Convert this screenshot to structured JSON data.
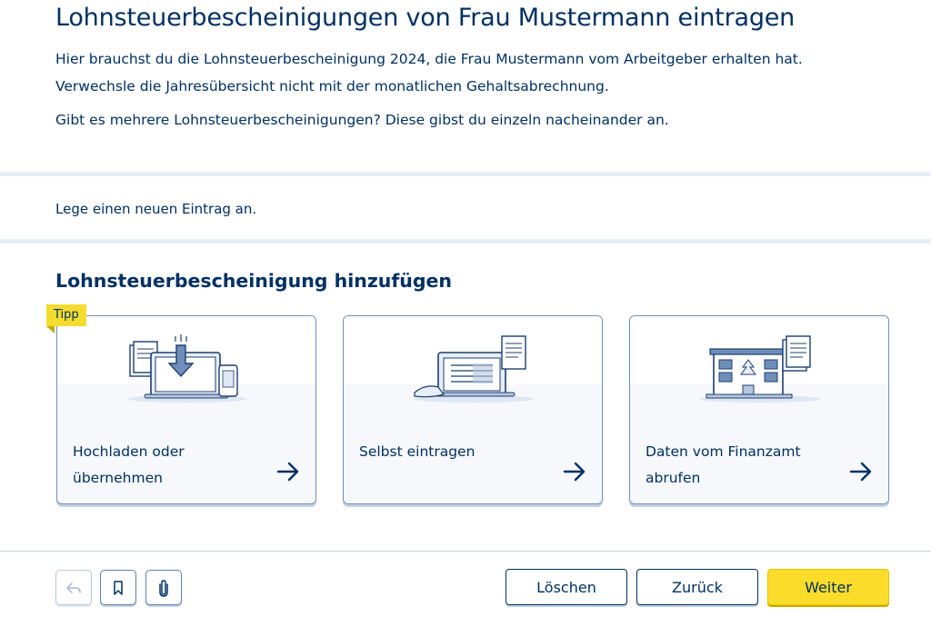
{
  "page": {
    "title": "Lohnsteuerbescheinigungen von Frau Mustermann eintragen",
    "intro_line1": "Hier brauchst du die Lohnsteuerbescheinigung 2024, die Frau Mustermann vom Arbeitgeber erhalten hat.",
    "intro_line2": "Verwechsle die Jahresübersicht nicht mit der monatlichen Gehaltsabrechnung.",
    "intro_line3": "Gibt es mehrere Lohnsteuerbescheinigungen? Diese gibst du einzeln nacheinander an."
  },
  "info": {
    "text": "Lege einen neuen Eintrag an."
  },
  "section": {
    "title": "Lohnsteuerbescheinigung hinzufügen",
    "tip_badge": "Tipp",
    "cards": [
      {
        "label_line1": "Hochladen oder",
        "label_line2": "übernehmen",
        "icon": "upload-devices-illustration"
      },
      {
        "label_line1": "Selbst eintragen",
        "label_line2": "",
        "icon": "manual-entry-illustration"
      },
      {
        "label_line1": "Daten vom Finanzamt",
        "label_line2": "abrufen",
        "icon": "tax-office-illustration"
      }
    ]
  },
  "footer": {
    "icons": [
      "undo-icon",
      "bookmark-icon",
      "paperclip-icon"
    ],
    "delete_label": "Löschen",
    "back_label": "Zurück",
    "next_label": "Weiter"
  },
  "colors": {
    "primary_text": "#003064",
    "accent_yellow": "#fcdc2a",
    "border_blue": "#6f8fba",
    "band": "#e8eef7"
  }
}
